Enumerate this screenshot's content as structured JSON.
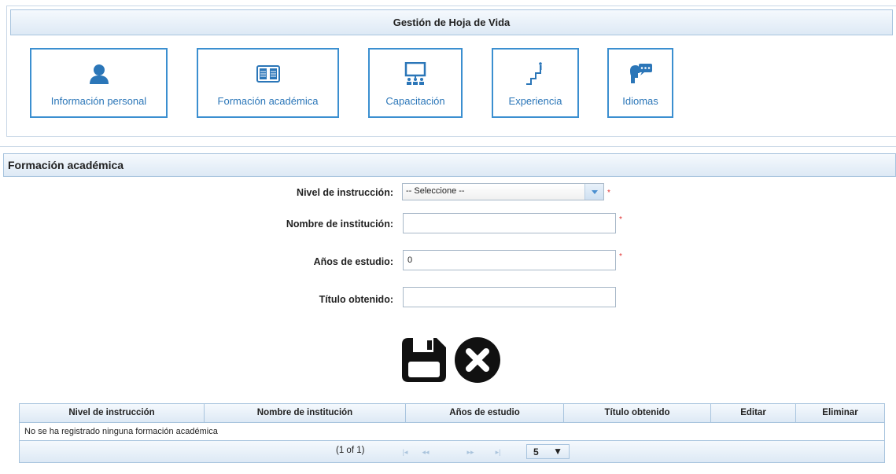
{
  "top": {
    "title": "Gestión de Hoja de Vida",
    "menu": [
      {
        "label": "Información personal",
        "icon": "person-icon"
      },
      {
        "label": "Formación académica",
        "icon": "book-icon"
      },
      {
        "label": "Capacitación",
        "icon": "classroom-icon"
      },
      {
        "label": "Experiencia",
        "icon": "stairs-icon"
      },
      {
        "label": "Idiomas",
        "icon": "speech-icon"
      }
    ]
  },
  "section": {
    "title": "Formación académica",
    "fields": {
      "nivel_label": "Nivel de instrucción:",
      "nivel_value": "-- Seleccione --",
      "institucion_label": "Nombre de institución:",
      "institucion_value": "",
      "anos_label": "Años de estudio:",
      "anos_value": "0",
      "titulo_label": "Título obtenido:",
      "titulo_value": "",
      "required_mark": "*"
    },
    "actions": {
      "save": "save-icon",
      "cancel": "cancel-icon"
    }
  },
  "grid": {
    "columns": [
      "Nivel de instrucción",
      "Nombre de institución",
      "Años de estudio",
      "Título obtenido",
      "Editar",
      "Eliminar"
    ],
    "empty_message": "No se ha registrado ninguna formación académica",
    "page_info": "(1 of 1)",
    "rows_per_page": "5",
    "paginator": {
      "first": "|◂",
      "prev": "◂◂",
      "next": "▸▸",
      "last": "▸|",
      "dropdown": "▼"
    }
  },
  "colors": {
    "accent": "#3b8fd0",
    "header_bg": "#dde9f5",
    "border": "#a8c4de",
    "required": "#e03030"
  }
}
